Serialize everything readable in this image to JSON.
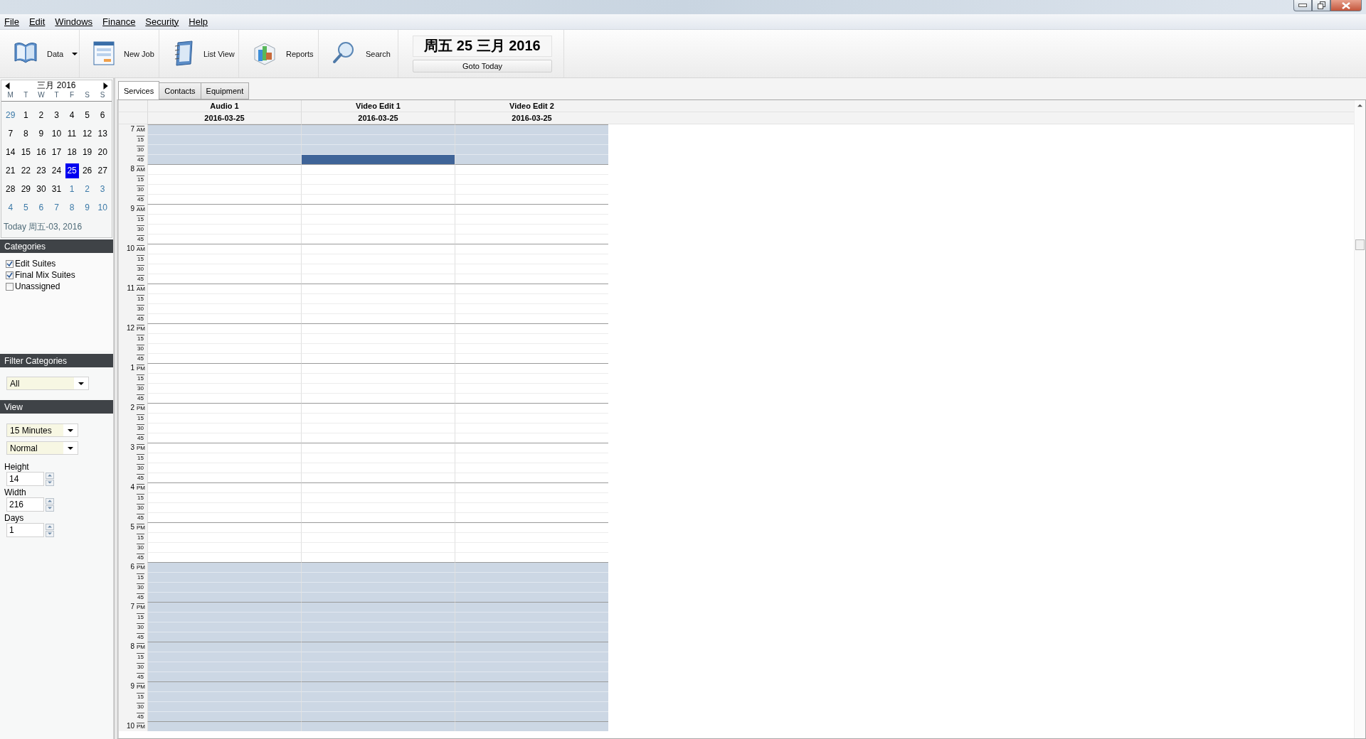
{
  "menu": [
    {
      "label": "File"
    },
    {
      "label": "Edit"
    },
    {
      "label": "Windows"
    },
    {
      "label": "Finance"
    },
    {
      "label": "Security"
    },
    {
      "label": "Help"
    }
  ],
  "toolbar": [
    {
      "kind": "data",
      "label": "Data"
    },
    {
      "kind": "new-job",
      "label": "New Job"
    },
    {
      "kind": "list-view",
      "label": "List View"
    },
    {
      "kind": "reports",
      "label": "Reports"
    },
    {
      "kind": "search",
      "label": "Search"
    }
  ],
  "date_panel": {
    "date": "周五 25 三月 2016",
    "button": "Goto Today"
  },
  "mini_calendar": {
    "month": "三月 2016",
    "weekdays": [
      "M",
      "T",
      "W",
      "T",
      "F",
      "S",
      "S"
    ],
    "weeks": [
      [
        {
          "day": "29",
          "muted": true,
          "selected": false
        },
        {
          "day": "1",
          "muted": false,
          "selected": false
        },
        {
          "day": "2",
          "muted": false,
          "selected": false
        },
        {
          "day": "3",
          "muted": false,
          "selected": false
        },
        {
          "day": "4",
          "muted": false,
          "selected": false
        },
        {
          "day": "5",
          "muted": false,
          "selected": false
        },
        {
          "day": "6",
          "muted": false,
          "selected": false
        }
      ],
      [
        {
          "day": "7",
          "muted": false,
          "selected": false
        },
        {
          "day": "8",
          "muted": false,
          "selected": false
        },
        {
          "day": "9",
          "muted": false,
          "selected": false
        },
        {
          "day": "10",
          "muted": false,
          "selected": false
        },
        {
          "day": "11",
          "muted": false,
          "selected": false
        },
        {
          "day": "12",
          "muted": false,
          "selected": false
        },
        {
          "day": "13",
          "muted": false,
          "selected": false
        }
      ],
      [
        {
          "day": "14",
          "muted": false,
          "selected": false
        },
        {
          "day": "15",
          "muted": false,
          "selected": false
        },
        {
          "day": "16",
          "muted": false,
          "selected": false
        },
        {
          "day": "17",
          "muted": false,
          "selected": false
        },
        {
          "day": "18",
          "muted": false,
          "selected": false
        },
        {
          "day": "19",
          "muted": false,
          "selected": false
        },
        {
          "day": "20",
          "muted": false,
          "selected": false
        }
      ],
      [
        {
          "day": "21",
          "muted": false,
          "selected": false
        },
        {
          "day": "22",
          "muted": false,
          "selected": false
        },
        {
          "day": "23",
          "muted": false,
          "selected": false
        },
        {
          "day": "24",
          "muted": false,
          "selected": false
        },
        {
          "day": "25",
          "muted": false,
          "selected": true
        },
        {
          "day": "26",
          "muted": false,
          "selected": false
        },
        {
          "day": "27",
          "muted": false,
          "selected": false
        }
      ],
      [
        {
          "day": "28",
          "muted": false,
          "selected": false
        },
        {
          "day": "29",
          "muted": false,
          "selected": false
        },
        {
          "day": "30",
          "muted": false,
          "selected": false
        },
        {
          "day": "31",
          "muted": false,
          "selected": false
        },
        {
          "day": "1",
          "muted": true,
          "selected": false
        },
        {
          "day": "2",
          "muted": true,
          "selected": false
        },
        {
          "day": "3",
          "muted": true,
          "selected": false
        }
      ],
      [
        {
          "day": "4",
          "muted": true,
          "selected": false
        },
        {
          "day": "5",
          "muted": true,
          "selected": false
        },
        {
          "day": "6",
          "muted": true,
          "selected": false
        },
        {
          "day": "7",
          "muted": true,
          "selected": false
        },
        {
          "day": "8",
          "muted": true,
          "selected": false
        },
        {
          "day": "9",
          "muted": true,
          "selected": false
        },
        {
          "day": "10",
          "muted": true,
          "selected": false
        }
      ]
    ],
    "today": "Today 周五-03, 2016"
  },
  "categories": {
    "title": "Categories",
    "items": [
      {
        "label": "Edit Suites",
        "checked": true
      },
      {
        "label": "Final Mix Suites",
        "checked": true
      },
      {
        "label": "Unassigned",
        "checked": false
      }
    ]
  },
  "filter_categories": {
    "title": "Filter Categories",
    "value": "All"
  },
  "view": {
    "title": "View",
    "interval": "15 Minutes",
    "mode": "Normal",
    "spinners": [
      {
        "label": "Height",
        "value": "14"
      },
      {
        "label": "Width",
        "value": "216"
      },
      {
        "label": "Days",
        "value": "1"
      }
    ]
  },
  "tabs": [
    {
      "label": "Services",
      "selected": true
    },
    {
      "label": "Contacts",
      "selected": false
    },
    {
      "label": "Equipment",
      "selected": false
    }
  ],
  "schedule": {
    "columns": [
      {
        "name": "Audio 1",
        "date": "2016-03-25"
      },
      {
        "name": "Video Edit 1",
        "date": "2016-03-25"
      },
      {
        "name": "Video Edit 2",
        "date": "2016-03-25"
      }
    ],
    "rows": [
      {
        "hour": "7",
        "period": "AM",
        "shaded": true,
        "booked": [
          false,
          false,
          false
        ]
      },
      {
        "minute": "15",
        "shaded": true,
        "booked": [
          false,
          false,
          false
        ]
      },
      {
        "minute": "30",
        "shaded": true,
        "booked": [
          false,
          false,
          false
        ]
      },
      {
        "minute": "45",
        "shaded": true,
        "booked": [
          false,
          true,
          false
        ]
      },
      {
        "hour": "8",
        "period": "AM",
        "shaded": false,
        "booked": [
          false,
          false,
          false
        ]
      },
      {
        "minute": "15",
        "shaded": false,
        "booked": [
          false,
          false,
          false
        ]
      },
      {
        "minute": "30",
        "shaded": false,
        "booked": [
          false,
          false,
          false
        ]
      },
      {
        "minute": "45",
        "shaded": false,
        "booked": [
          false,
          false,
          false
        ]
      },
      {
        "hour": "9",
        "period": "AM",
        "shaded": false,
        "booked": [
          false,
          false,
          false
        ]
      },
      {
        "minute": "15",
        "shaded": false,
        "booked": [
          false,
          false,
          false
        ]
      },
      {
        "minute": "30",
        "shaded": false,
        "booked": [
          false,
          false,
          false
        ]
      },
      {
        "minute": "45",
        "shaded": false,
        "booked": [
          false,
          false,
          false
        ]
      },
      {
        "hour": "10",
        "period": "AM",
        "shaded": false,
        "booked": [
          false,
          false,
          false
        ]
      },
      {
        "minute": "15",
        "shaded": false,
        "booked": [
          false,
          false,
          false
        ]
      },
      {
        "minute": "30",
        "shaded": false,
        "booked": [
          false,
          false,
          false
        ]
      },
      {
        "minute": "45",
        "shaded": false,
        "booked": [
          false,
          false,
          false
        ]
      },
      {
        "hour": "11",
        "period": "AM",
        "shaded": false,
        "booked": [
          false,
          false,
          false
        ]
      },
      {
        "minute": "15",
        "shaded": false,
        "booked": [
          false,
          false,
          false
        ]
      },
      {
        "minute": "30",
        "shaded": false,
        "booked": [
          false,
          false,
          false
        ]
      },
      {
        "minute": "45",
        "shaded": false,
        "booked": [
          false,
          false,
          false
        ]
      },
      {
        "hour": "12",
        "period": "PM",
        "shaded": false,
        "booked": [
          false,
          false,
          false
        ]
      },
      {
        "minute": "15",
        "shaded": false,
        "booked": [
          false,
          false,
          false
        ]
      },
      {
        "minute": "30",
        "shaded": false,
        "booked": [
          false,
          false,
          false
        ]
      },
      {
        "minute": "45",
        "shaded": false,
        "booked": [
          false,
          false,
          false
        ]
      },
      {
        "hour": "1",
        "period": "PM",
        "shaded": false,
        "booked": [
          false,
          false,
          false
        ]
      },
      {
        "minute": "15",
        "shaded": false,
        "booked": [
          false,
          false,
          false
        ]
      },
      {
        "minute": "30",
        "shaded": false,
        "booked": [
          false,
          false,
          false
        ]
      },
      {
        "minute": "45",
        "shaded": false,
        "booked": [
          false,
          false,
          false
        ]
      },
      {
        "hour": "2",
        "period": "PM",
        "shaded": false,
        "booked": [
          false,
          false,
          false
        ]
      },
      {
        "minute": "15",
        "shaded": false,
        "booked": [
          false,
          false,
          false
        ]
      },
      {
        "minute": "30",
        "shaded": false,
        "booked": [
          false,
          false,
          false
        ]
      },
      {
        "minute": "45",
        "shaded": false,
        "booked": [
          false,
          false,
          false
        ]
      },
      {
        "hour": "3",
        "period": "PM",
        "shaded": false,
        "booked": [
          false,
          false,
          false
        ]
      },
      {
        "minute": "15",
        "shaded": false,
        "booked": [
          false,
          false,
          false
        ]
      },
      {
        "minute": "30",
        "shaded": false,
        "booked": [
          false,
          false,
          false
        ]
      },
      {
        "minute": "45",
        "shaded": false,
        "booked": [
          false,
          false,
          false
        ]
      },
      {
        "hour": "4",
        "period": "PM",
        "shaded": false,
        "booked": [
          false,
          false,
          false
        ]
      },
      {
        "minute": "15",
        "shaded": false,
        "booked": [
          false,
          false,
          false
        ]
      },
      {
        "minute": "30",
        "shaded": false,
        "booked": [
          false,
          false,
          false
        ]
      },
      {
        "minute": "45",
        "shaded": false,
        "booked": [
          false,
          false,
          false
        ]
      },
      {
        "hour": "5",
        "period": "PM",
        "shaded": false,
        "booked": [
          false,
          false,
          false
        ]
      },
      {
        "minute": "15",
        "shaded": false,
        "booked": [
          false,
          false,
          false
        ]
      },
      {
        "minute": "30",
        "shaded": false,
        "booked": [
          false,
          false,
          false
        ]
      },
      {
        "minute": "45",
        "shaded": false,
        "booked": [
          false,
          false,
          false
        ]
      },
      {
        "hour": "6",
        "period": "PM",
        "shaded": true,
        "booked": [
          false,
          false,
          false
        ]
      },
      {
        "minute": "15",
        "shaded": true,
        "booked": [
          false,
          false,
          false
        ]
      },
      {
        "minute": "30",
        "shaded": true,
        "booked": [
          false,
          false,
          false
        ]
      },
      {
        "minute": "45",
        "shaded": true,
        "booked": [
          false,
          false,
          false
        ]
      },
      {
        "hour": "7",
        "period": "PM",
        "shaded": true,
        "booked": [
          false,
          false,
          false
        ]
      },
      {
        "minute": "15",
        "shaded": true,
        "booked": [
          false,
          false,
          false
        ]
      },
      {
        "minute": "30",
        "shaded": true,
        "booked": [
          false,
          false,
          false
        ]
      },
      {
        "minute": "45",
        "shaded": true,
        "booked": [
          false,
          false,
          false
        ]
      },
      {
        "hour": "8",
        "period": "PM",
        "shaded": true,
        "booked": [
          false,
          false,
          false
        ]
      },
      {
        "minute": "15",
        "shaded": true,
        "booked": [
          false,
          false,
          false
        ]
      },
      {
        "minute": "30",
        "shaded": true,
        "booked": [
          false,
          false,
          false
        ]
      },
      {
        "minute": "45",
        "shaded": true,
        "booked": [
          false,
          false,
          false
        ]
      },
      {
        "hour": "9",
        "period": "PM",
        "shaded": true,
        "booked": [
          false,
          false,
          false
        ]
      },
      {
        "minute": "15",
        "shaded": true,
        "booked": [
          false,
          false,
          false
        ]
      },
      {
        "minute": "30",
        "shaded": true,
        "booked": [
          false,
          false,
          false
        ]
      },
      {
        "minute": "45",
        "shaded": true,
        "booked": [
          false,
          false,
          false
        ]
      },
      {
        "hour": "10",
        "period": "PM",
        "shaded": true,
        "booked": [
          false,
          false,
          false
        ]
      }
    ]
  }
}
